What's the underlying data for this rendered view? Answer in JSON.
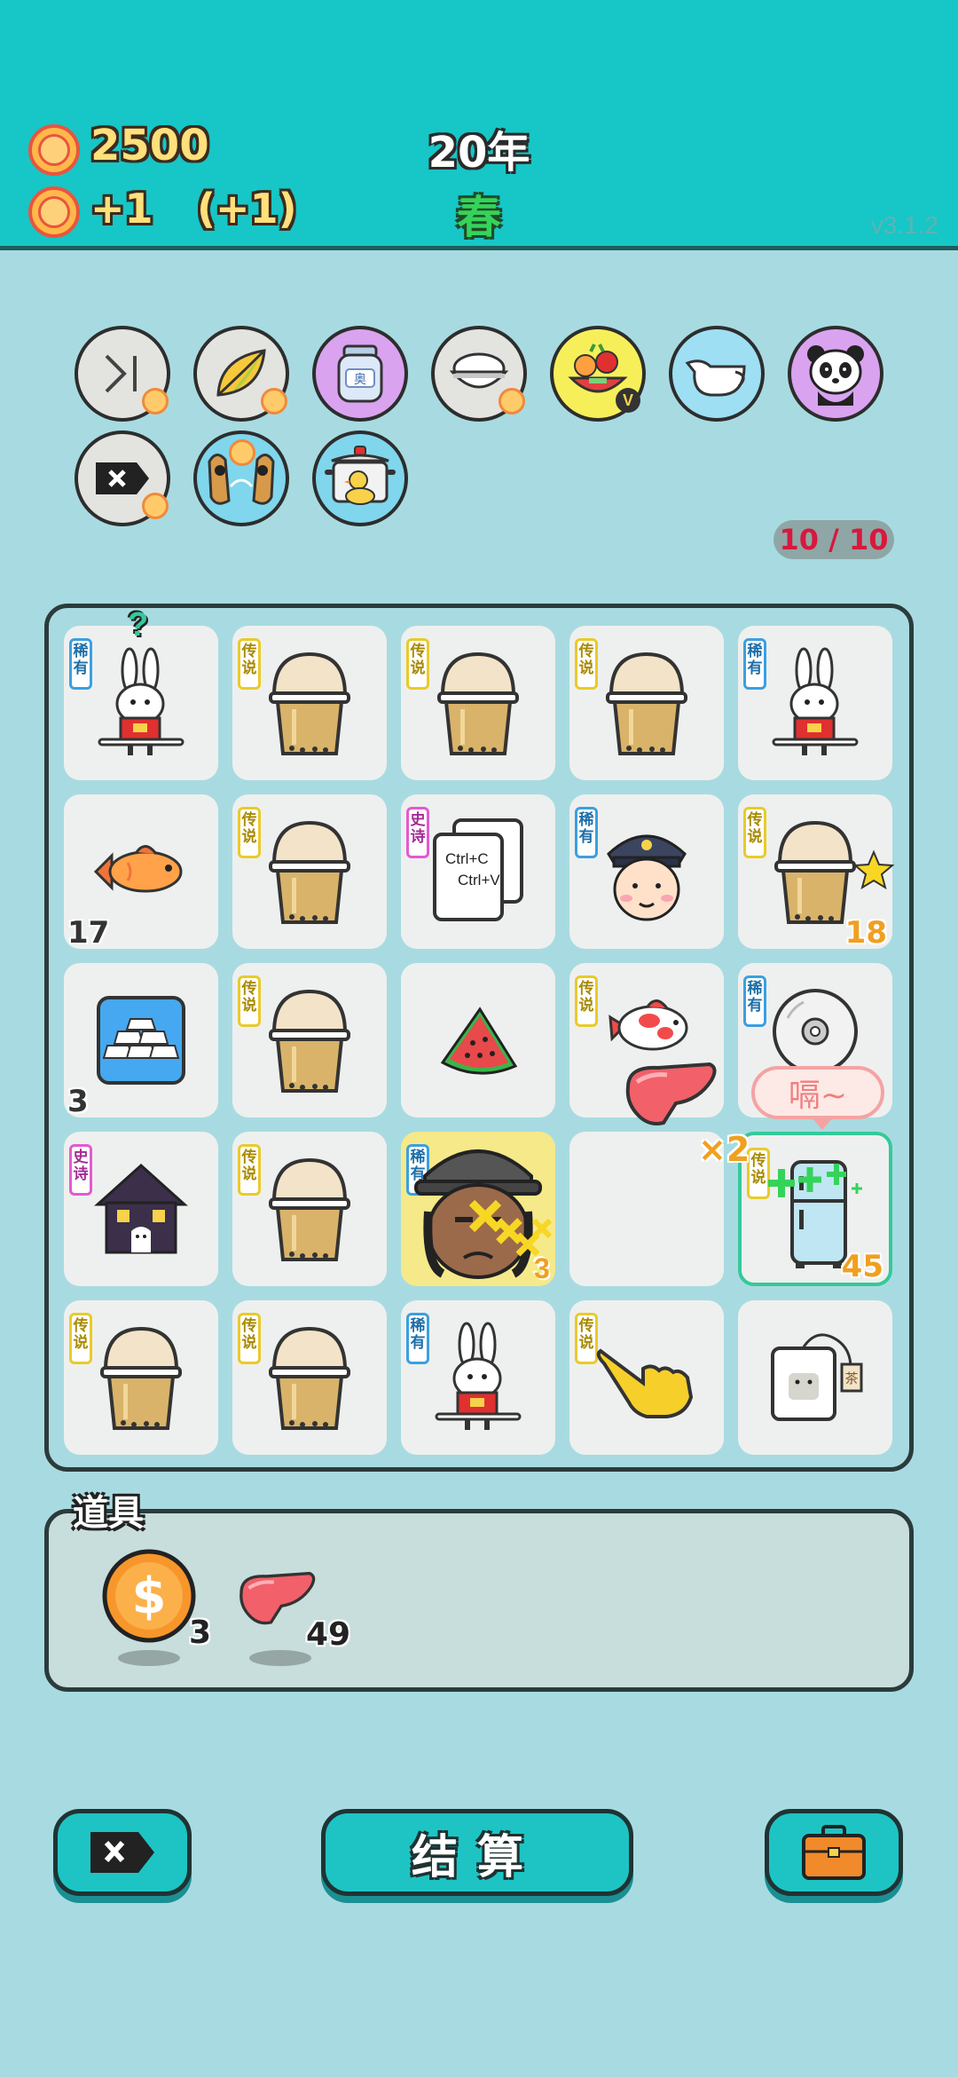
{
  "header": {
    "coins": "2500",
    "income": "+1",
    "bonus": "(+1)",
    "year": "20年",
    "season": "春",
    "version": "v3.1.2"
  },
  "tools": [
    {
      "name": "skip-icon"
    },
    {
      "name": "leaf-icon"
    },
    {
      "name": "jar-icon",
      "label": "奥"
    },
    {
      "name": "rice-bowl-icon"
    },
    {
      "name": "fruit-basket-icon",
      "badge": "V"
    },
    {
      "name": "milk-jug-icon"
    },
    {
      "name": "panda-icon"
    },
    {
      "name": "remove-icon"
    },
    {
      "name": "owls-icon"
    },
    {
      "name": "duck-pot-icon"
    }
  ],
  "slot_counter": "10 / 10",
  "tag_labels": {
    "legend": "传说",
    "rare": "稀有",
    "epic": "史诗"
  },
  "board": [
    {
      "row": 0,
      "col": 0,
      "item": "rabbit",
      "tag": "rare",
      "extra": "?"
    },
    {
      "row": 0,
      "col": 1,
      "item": "bubble-tea",
      "tag": "legend"
    },
    {
      "row": 0,
      "col": 2,
      "item": "bubble-tea",
      "tag": "legend"
    },
    {
      "row": 0,
      "col": 3,
      "item": "bubble-tea",
      "tag": "legend"
    },
    {
      "row": 0,
      "col": 4,
      "item": "rabbit",
      "tag": "rare"
    },
    {
      "row": 1,
      "col": 0,
      "item": "fish",
      "count": "17"
    },
    {
      "row": 1,
      "col": 1,
      "item": "bubble-tea",
      "tag": "legend"
    },
    {
      "row": 1,
      "col": 2,
      "item": "copy-paste",
      "tag": "epic",
      "text1": "Ctrl+C",
      "text2": "Ctrl+V"
    },
    {
      "row": 1,
      "col": 3,
      "item": "police-officer",
      "tag": "rare"
    },
    {
      "row": 1,
      "col": 4,
      "item": "bubble-tea",
      "tag": "legend",
      "count": "18"
    },
    {
      "row": 2,
      "col": 0,
      "item": "gold-bars",
      "count": "3"
    },
    {
      "row": 2,
      "col": 1,
      "item": "bubble-tea",
      "tag": "legend"
    },
    {
      "row": 2,
      "col": 2,
      "item": "watermelon"
    },
    {
      "row": 2,
      "col": 3,
      "item": "koi-fish",
      "tag": "legend"
    },
    {
      "row": 2,
      "col": 4,
      "item": "cd-disc",
      "tag": "rare"
    },
    {
      "row": 3,
      "col": 0,
      "item": "haunted-house",
      "tag": "epic"
    },
    {
      "row": 3,
      "col": 1,
      "item": "bubble-tea",
      "tag": "legend"
    },
    {
      "row": 3,
      "col": 2,
      "item": "hat-man",
      "tag": "rare"
    },
    {
      "row": 3,
      "col": 3,
      "item": "empty"
    },
    {
      "row": 3,
      "col": 4,
      "item": "fridge",
      "tag": "legend",
      "count": "45"
    },
    {
      "row": 4,
      "col": 0,
      "item": "bubble-tea",
      "tag": "legend"
    },
    {
      "row": 4,
      "col": 1,
      "item": "bubble-tea",
      "tag": "legend"
    },
    {
      "row": 4,
      "col": 2,
      "item": "rabbit",
      "tag": "rare"
    },
    {
      "row": 4,
      "col": 3,
      "item": "pointing-hand",
      "tag": "legend"
    },
    {
      "row": 4,
      "col": 4,
      "item": "tea-bag",
      "label": "茶"
    }
  ],
  "effects": {
    "speech": "嗝~",
    "multiplier": "×2",
    "hat_man_multiplier": "3"
  },
  "items_panel": {
    "label": "道具",
    "items": [
      {
        "name": "dollar-coin",
        "count": "3"
      },
      {
        "name": "liver",
        "count": "49"
      }
    ]
  },
  "buttons": {
    "settle": "结算"
  },
  "colors": {
    "header_bg": "#17c6c6",
    "page_bg": "#a8dbe1",
    "button_bg": "#1ec4c4",
    "coin_text": "#ffe07a",
    "season_text": "#35d35a",
    "counter_text": "#d8183c"
  }
}
